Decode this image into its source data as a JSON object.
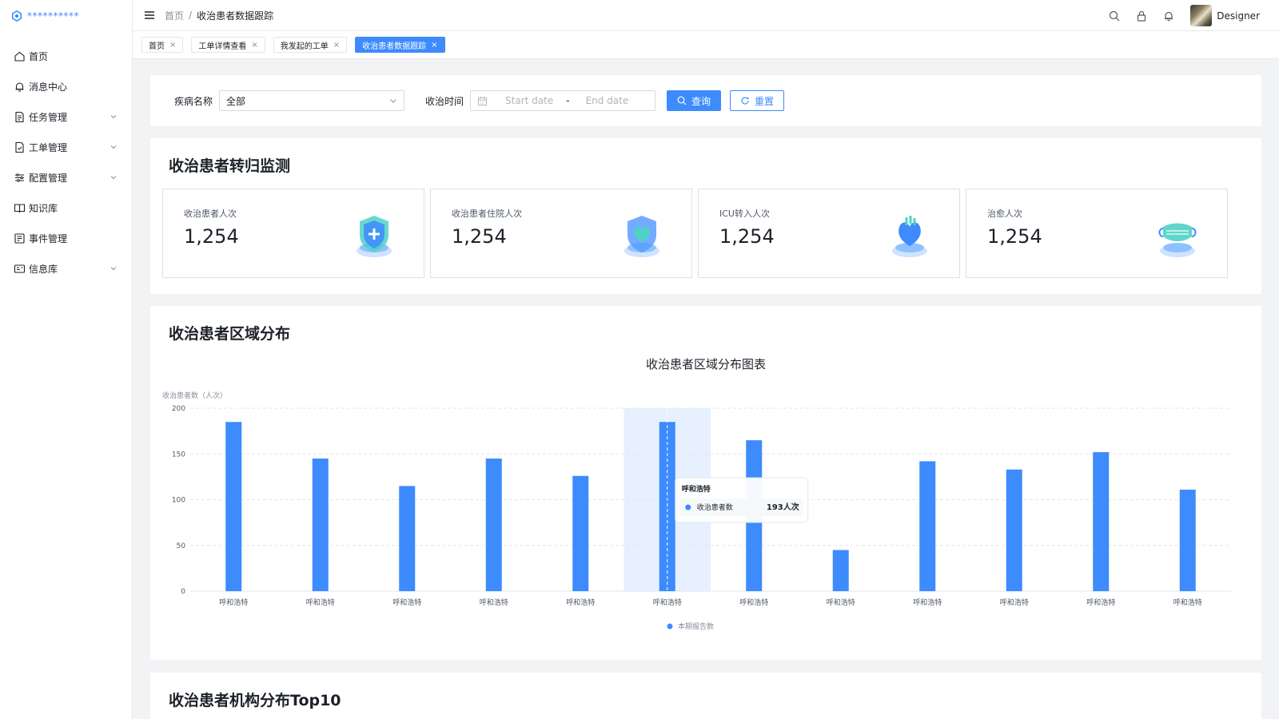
{
  "sidebar": {
    "logo_text": "**********",
    "items": [
      {
        "label": "首页",
        "icon": "home-icon",
        "has_children": false
      },
      {
        "label": "消息中心",
        "icon": "bell-icon",
        "has_children": false
      },
      {
        "label": "任务管理",
        "icon": "document-icon",
        "has_children": true
      },
      {
        "label": "工单管理",
        "icon": "file-check-icon",
        "has_children": true
      },
      {
        "label": "配置管理",
        "icon": "sliders-icon",
        "has_children": true
      },
      {
        "label": "知识库",
        "icon": "book-icon",
        "has_children": false
      },
      {
        "label": "事件管理",
        "icon": "event-icon",
        "has_children": false
      },
      {
        "label": "信息库",
        "icon": "id-card-icon",
        "has_children": true
      }
    ]
  },
  "header": {
    "breadcrumb": [
      "首页",
      "收治患者数据跟踪"
    ],
    "separator": "/",
    "username": "Designer"
  },
  "tabs": [
    {
      "label": "首页",
      "active": false
    },
    {
      "label": "工单详情查看",
      "active": false
    },
    {
      "label": "我发起的工单",
      "active": false
    },
    {
      "label": "收治患者数据跟踪",
      "active": true
    }
  ],
  "filter": {
    "disease_label": "疾病名称",
    "disease_value": "全部",
    "time_label": "收治时间",
    "start_placeholder": "Start date",
    "end_placeholder": "End date",
    "date_separator": "-",
    "query_button": "查询",
    "reset_button": "重置"
  },
  "monitor": {
    "title": "收治患者转归监测",
    "stats": [
      {
        "label": "收治患者人次",
        "value": "1,254",
        "icon": "shield-plus-icon"
      },
      {
        "label": "收治患者住院人次",
        "value": "1,254",
        "icon": "heart-shield-icon"
      },
      {
        "label": "ICU转入人次",
        "value": "1,254",
        "icon": "heart-organ-icon"
      },
      {
        "label": "治愈人次",
        "value": "1,254",
        "icon": "mask-icon"
      }
    ]
  },
  "region": {
    "title": "收治患者区域分布"
  },
  "top10": {
    "title": "收治患者机构分布Top10"
  },
  "chart_data": {
    "type": "bar",
    "title": "收治患者区域分布图表",
    "ylabel": "收治患者数（人次）",
    "xlabel": "",
    "ylim": [
      0,
      200
    ],
    "yticks": [
      0,
      50,
      100,
      150,
      200
    ],
    "categories": [
      "呼和浩特",
      "呼和浩特",
      "呼和浩特",
      "呼和浩特",
      "呼和浩特",
      "呼和浩特",
      "呼和浩特",
      "呼和浩特",
      "呼和浩特",
      "呼和浩特",
      "呼和浩特",
      "呼和浩特"
    ],
    "series": [
      {
        "name": "本期报告数",
        "values": [
          185,
          145,
          115,
          145,
          126,
          185,
          165,
          45,
          142,
          133,
          152,
          111
        ]
      }
    ],
    "legend_position": "bottom-center",
    "grid": true,
    "highlight_index": 5,
    "tooltip": {
      "title": "呼和浩特",
      "series_label": "收治患者数",
      "value_text": "193人次"
    },
    "colors": {
      "bar": "#3d8bfd",
      "highlight": "#e6f0ff"
    }
  }
}
